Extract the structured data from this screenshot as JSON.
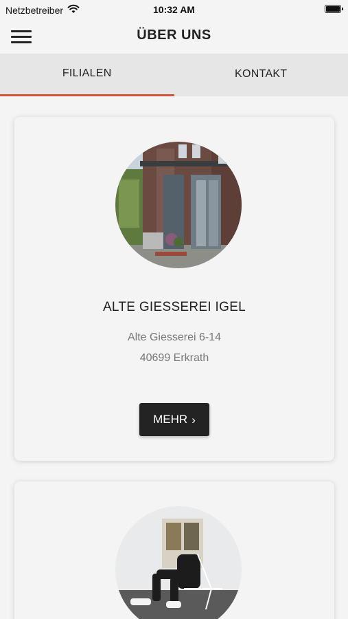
{
  "status_bar": {
    "carrier": "Netzbetreiber",
    "time": "10:32 AM"
  },
  "header": {
    "title": "ÜBER UNS"
  },
  "tabs": [
    {
      "label": "FILIALEN",
      "active": true
    },
    {
      "label": "KONTAKT",
      "active": false
    }
  ],
  "colors": {
    "accent": "#d0553a",
    "button_bg": "#232323",
    "background": "#f4f4f4"
  },
  "branches": [
    {
      "name": "ALTE GIESSEREI IGEL",
      "street": "Alte Giesserei 6-14",
      "city": "40699 Erkrath",
      "more_label": "MEHR"
    }
  ],
  "icons": {
    "menu": "hamburger-menu-icon",
    "wifi": "wifi-icon",
    "battery": "battery-icon",
    "more": "chevron-right-icon"
  }
}
